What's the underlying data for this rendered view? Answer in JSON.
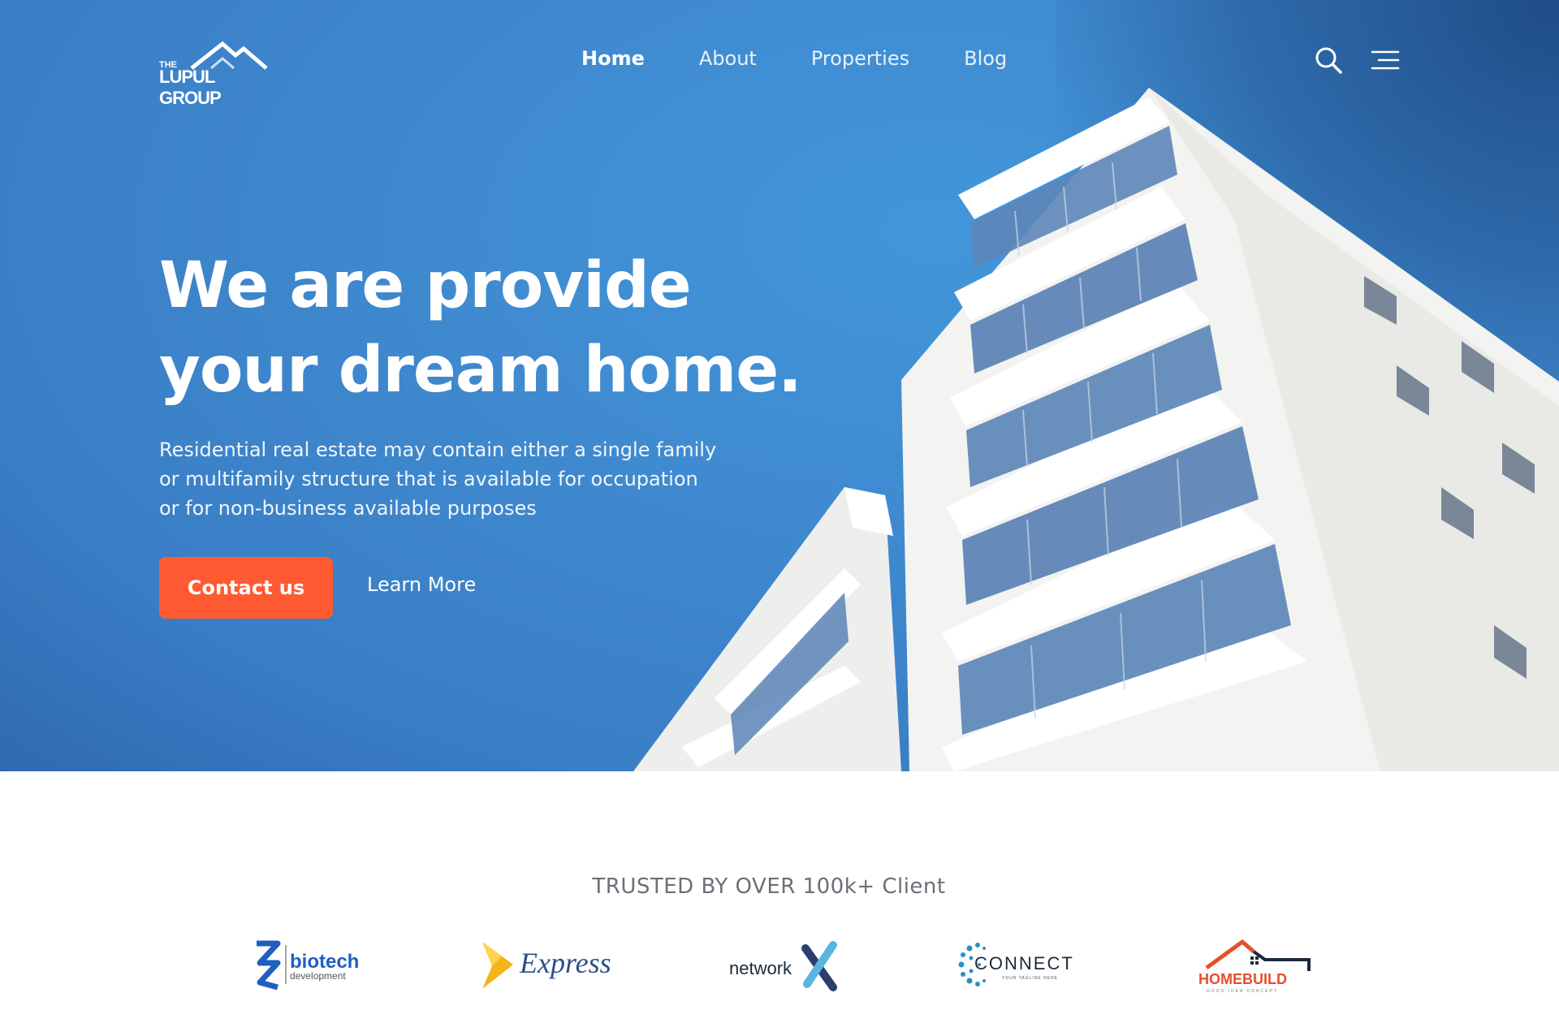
{
  "brand": {
    "logo_the": "THE",
    "logo_name": "LUPUL GROUP"
  },
  "nav": {
    "items": [
      {
        "label": "Home",
        "active": true
      },
      {
        "label": "About",
        "active": false
      },
      {
        "label": "Properties",
        "active": false
      },
      {
        "label": "Blog",
        "active": false
      }
    ],
    "icons": [
      "search-icon",
      "menu-icon"
    ]
  },
  "hero": {
    "headline_line1": "We are provide",
    "headline_line2": "your dream home.",
    "subtitle_line1": "Residential real estate may contain either a single family",
    "subtitle_line2": "or multifamily structure that is available for occupation",
    "subtitle_line3": "or for non-business available purposes",
    "primary_button": "Contact us",
    "secondary_button": "Learn More"
  },
  "trusted": {
    "heading": "TRUSTED BY OVER 100k+ Client",
    "logos": [
      {
        "name": "biotech",
        "sub": "development"
      },
      {
        "name": "Express"
      },
      {
        "name": "network"
      },
      {
        "name": "CONNECT",
        "tagline": "YOUR TAGLINE HERE"
      },
      {
        "name": "HOMEBUILD",
        "tagline": "GOOD IDEA CONCEPT"
      }
    ]
  },
  "colors": {
    "hero_blue": "#3f89cf",
    "accent_orange": "#ff5a32",
    "trusted_text": "#6b6f76"
  }
}
